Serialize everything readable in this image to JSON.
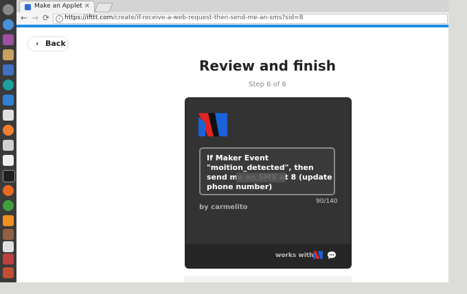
{
  "browser": {
    "tab_title": "Make an Applet - IF",
    "tab_close": "×",
    "url_host": "https://ifttt.com",
    "url_path": "/create/if-receive-a-web-request-then-send-me-an-sms?sid=8",
    "nav": {
      "back": "←",
      "forward": "→",
      "reload": "⟳"
    },
    "info_glyph": "i"
  },
  "page": {
    "back_label": "Back",
    "back_glyph": "‹",
    "title": "Review and finish",
    "step": "Step 6 of 6"
  },
  "card": {
    "message": "If Maker Event \"moition_detected\", then send me an SMS at            8 (update phone number)",
    "counter": "90/140",
    "byline": "by carmelito",
    "works_with": "works with"
  },
  "colors": {
    "accent": "#1e8be6",
    "card_bg": "#333333",
    "maker_red": "#e02424",
    "maker_blue": "#1a63d8"
  },
  "launcher_icons": [
    "ubuntu-logo-icon",
    "chrome-icon",
    "window-manager-icon",
    "files-icon",
    "photo-icon",
    "arduino-icon",
    "apps-icon",
    "ubuntu-software-icon",
    "orange-app-icon",
    "drive-icon",
    "editor-icon",
    "terminal-icon",
    "firefox-icon",
    "globe-icon",
    "vlc-icon",
    "books-icon",
    "doc-icon",
    "network-icon",
    "trash-icon"
  ]
}
